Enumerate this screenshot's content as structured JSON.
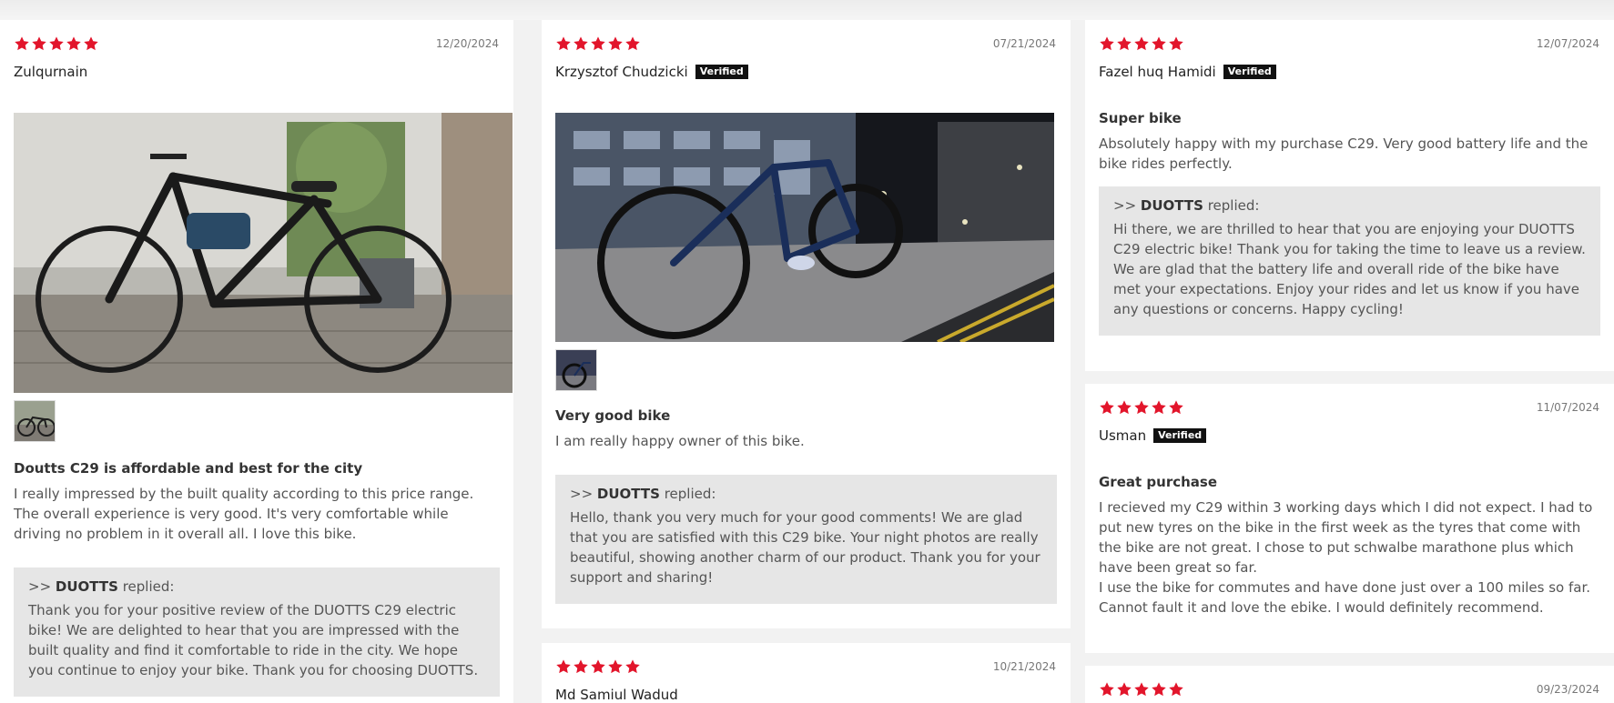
{
  "colors": {
    "star": "#e2152b",
    "badge": "#111111",
    "reply_bg": "#e6e6e6"
  },
  "icons": {
    "rating": "star-icon"
  },
  "reviews": [
    {
      "rating": 5,
      "date": "12/20/2024",
      "author": "Zulqurnain",
      "verified_label": "",
      "title": "Doutts C29 is affordable and best for the city",
      "body": "I really impressed by the built quality according to this price range. The overall experience is very good. It's very comfortable while driving no problem in it overall all. I love this bike.",
      "reply_prefix": ">>",
      "reply_author": "DUOTTS",
      "reply_word": "replied:",
      "reply_text": "Thank you for your positive review of the DUOTTS C29 electric bike! We are delighted to hear that you are impressed with the built quality and find it comfortable to ride in the city. We hope you continue to enjoy your bike. Thank you for choosing DUOTTS."
    },
    {
      "rating": 5,
      "date": "07/21/2024",
      "author": "Krzysztof Chudzicki",
      "verified_label": "Verified",
      "title": "Very good bike",
      "body": "I am really happy owner of this bike.",
      "reply_prefix": ">>",
      "reply_author": "DUOTTS",
      "reply_word": "replied:",
      "reply_text": "Hello, thank you very much for your good comments! We are glad that you are satisfied with this C29 bike. Your night photos are really beautiful, showing another charm of our product. Thank you for your support and sharing!"
    },
    {
      "rating": 5,
      "date": "10/21/2024",
      "author": "Md Samiul Wadud",
      "verified_label": ""
    },
    {
      "rating": 5,
      "date": "12/07/2024",
      "author": "Fazel huq Hamidi",
      "verified_label": "Verified",
      "title": "Super bike",
      "body": "Absolutely happy with my purchase C29. Very good battery life and the bike rides perfectly.",
      "reply_prefix": ">>",
      "reply_author": "DUOTTS",
      "reply_word": "replied:",
      "reply_text": "Hi there, we are thrilled to hear that you are enjoying your DUOTTS C29 electric bike! Thank you for taking the time to leave us a review. We are glad that the battery life and overall ride of the bike have met your expectations. Enjoy your rides and let us know if you have any questions or concerns. Happy cycling!"
    },
    {
      "rating": 5,
      "date": "11/07/2024",
      "author": "Usman",
      "verified_label": "Verified",
      "title": "Great purchase",
      "body": "I recieved my C29 within 3 working days which I did not expect. I had to put new tyres on the bike in the first week as the tyres that come with the bike are not great. I chose to put schwalbe marathone plus which have been great so far.",
      "body2": "I use the bike for commutes and have done just over a 100 miles so far. Cannot fault it and love the ebike. I would definitely recommend."
    },
    {
      "rating": 5,
      "date": "09/23/2024",
      "author": "",
      "verified_label": ""
    }
  ]
}
